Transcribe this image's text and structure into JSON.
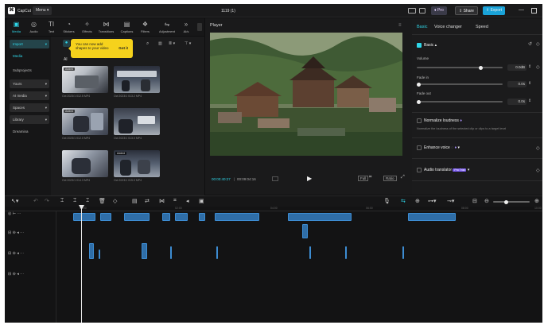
{
  "app": {
    "name": "CapCut",
    "menu": "Menu",
    "project_title": "1119 (1)"
  },
  "titlebar": {
    "pro": "Pro",
    "share": "Share",
    "export": "Export"
  },
  "toolbar": {
    "items": [
      {
        "label": "Media",
        "icon": "media-icon",
        "active": true
      },
      {
        "label": "Audio",
        "icon": "audio-icon"
      },
      {
        "label": "Text",
        "icon": "text-icon"
      },
      {
        "label": "Stickers",
        "icon": "sticker-icon"
      },
      {
        "label": "Effects",
        "icon": "effects-icon"
      },
      {
        "label": "Transitions",
        "icon": "transitions-icon"
      },
      {
        "label": "Captions",
        "icon": "captions-icon"
      },
      {
        "label": "Filters",
        "icon": "filters-icon"
      },
      {
        "label": "Adjustment",
        "icon": "adjustment-icon"
      },
      {
        "label": "Al/s",
        "icon": "more-icon"
      }
    ]
  },
  "leftnav": {
    "import": "Import",
    "items": [
      "Media",
      "Subprojects",
      "Yours",
      "AI media",
      "Spaces",
      "Library",
      "Dreamina"
    ]
  },
  "media": {
    "filter_all": "Al",
    "tooltip_text": "You can now add shapes to your video",
    "tooltip_button": "Got it",
    "thumbs": [
      {
        "caption": "Oct 2023/1 012.5 MP4",
        "added": "Added"
      },
      {
        "caption": "Oct 2023/1 013.2 MP4",
        "added": ""
      },
      {
        "caption": "Oct 2023/1 012.0 MP4",
        "added": "Added"
      },
      {
        "caption": "Oct 2023/1 013.0 MP4",
        "added": ""
      },
      {
        "caption": "Oct 2023/1 014.3 MP4",
        "added": ""
      },
      {
        "caption": "Oct 2023/1 015.0 MP4",
        "added": "Added"
      }
    ]
  },
  "player": {
    "title": "Player",
    "time_current": "00:00:40:27",
    "time_total": "00:09:04:16",
    "fit": "Full",
    "ratio": "Ratio"
  },
  "rightpanel": {
    "tabs": [
      "Basic",
      "Voice changer",
      "Speed"
    ],
    "section": "Basic",
    "volume_label": "Volume",
    "volume_value": "0.0dB",
    "fadein_label": "Fade in",
    "fadein_value": "0.0s",
    "fadeout_label": "Fade out",
    "fadeout_value": "0.0s",
    "normalize_label": "Normalize loudness",
    "normalize_desc": "Normalize the loudness of the selected clip or clips to a target level",
    "enhance_label": "Enhance voice",
    "translator_label": "Audio translator",
    "translator_badge": "Pro Trial"
  },
  "timeline": {
    "ticks": [
      "00:00",
      "02:00",
      "04:00",
      "06:00",
      "08:00",
      "10:00"
    ]
  },
  "colors": {
    "accent": "#2fd6e8",
    "export": "#1aa3d9",
    "clip": "#2f6ea8"
  }
}
